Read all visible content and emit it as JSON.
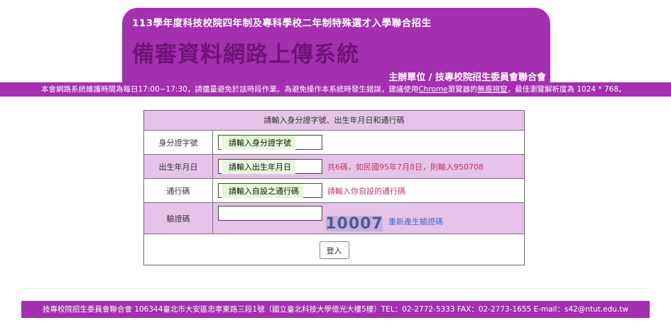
{
  "banner": {
    "subtitle": "113學年度科技校院四年制及專科學校二年制特殊選才入學聯合招生",
    "title": "備審資料網路上傳系統",
    "organizer": "主辦單位 / 技專校院招生委員會聯合會"
  },
  "notice": {
    "prefix": "本會網路系統維護時間為每日17:00~17:30，請儘量避免於該時段作業。為避免操作本系統時發生錯誤，建議使用",
    "chrome": "Chrome",
    "mid": "瀏覽器的",
    "incognito": "無痕視窗",
    "suffix": "，最佳瀏覽解析度為 1024 * 768。"
  },
  "form": {
    "header": "請輸入身分證字號、出生年月日和通行碼",
    "id_label": "身分證字號",
    "id_placeholder": "請輸入身分證字號",
    "birth_label": "出生年月日",
    "birth_placeholder": "請輸入出生年月日",
    "birth_hint": "共6碼，如民國95年7月8日，則輸入950708",
    "pass_label": "通行碼",
    "pass_placeholder": "請輸入自設之通行碼",
    "pass_hint": "請輸入你自設的通行碼",
    "captcha_label": "驗證碼",
    "captcha_value": "",
    "captcha_code": "10007",
    "regen_label": "重新產生驗證碼",
    "login_label": "登入"
  },
  "footer": {
    "text": "技專校院招生委員會聯合會 106344臺北市大安區忠孝東路三段1號（國立臺北科技大學億光大樓5樓）TEL：02-2772-5333 FAX：02-2773-1655 E-mail：s42@ntut.edu.tw"
  },
  "colors": {
    "brand": "#a42fb0",
    "title": "#6e1577",
    "row_pink": "#e6c4ea",
    "hint": "#c0385a",
    "link": "#3a6bc9"
  }
}
